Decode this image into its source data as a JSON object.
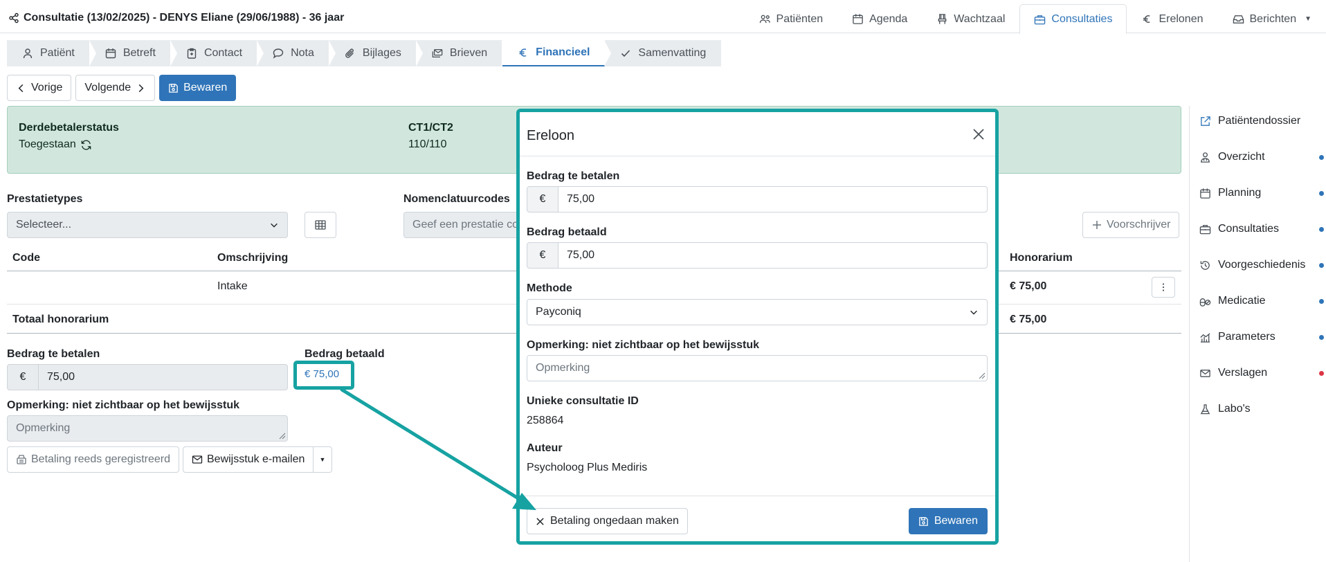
{
  "header": {
    "title": "Consultatie (13/02/2025) - DENYS Eliane (29/06/1988) - 36 jaar",
    "nav": [
      {
        "label": "Patiënten",
        "icon": "users-icon"
      },
      {
        "label": "Agenda",
        "icon": "calendar-icon"
      },
      {
        "label": "Wachtzaal",
        "icon": "chair-icon"
      },
      {
        "label": "Consultaties",
        "icon": "briefcase-icon",
        "active": true
      },
      {
        "label": "Erelonen",
        "icon": "euro-icon"
      },
      {
        "label": "Berichten",
        "icon": "inbox-icon"
      }
    ]
  },
  "subtabs": [
    {
      "label": "Patiënt",
      "icon": "user-icon"
    },
    {
      "label": "Betreft",
      "icon": "calendar-icon"
    },
    {
      "label": "Contact",
      "icon": "clipboard-icon"
    },
    {
      "label": "Nota",
      "icon": "comment-icon"
    },
    {
      "label": "Bijlages",
      "icon": "paperclip-icon"
    },
    {
      "label": "Brieven",
      "icon": "envelopes-icon"
    },
    {
      "label": "Financieel",
      "icon": "euro-icon",
      "active": true
    },
    {
      "label": "Samenvatting",
      "icon": "check-icon"
    }
  ],
  "navigation": {
    "prev": "Vorige",
    "next": "Volgende",
    "save": "Bewaren"
  },
  "status": {
    "third_party_label": "Derdebetalerstatus",
    "third_party_value": "Toegestaan",
    "ct_label": "CT1/CT2",
    "ct_value": "110/110"
  },
  "form": {
    "prestatietypes_label": "Prestatietypes",
    "prestatietypes_value": "Selecteer...",
    "nomenclature_label": "Nomenclatuurcodes",
    "nomenclature_placeholder": "Geef een prestatie co",
    "prescriber_button": "Voorschrijver"
  },
  "table": {
    "headers": {
      "code": "Code",
      "description": "Omschrijving",
      "fee": "Honorarium"
    },
    "rows": [
      {
        "code": "",
        "description": "Intake",
        "fee": "€ 75,00"
      }
    ],
    "total_label": "Totaal honorarium",
    "total_value": "€ 75,00"
  },
  "payment": {
    "to_pay_label": "Bedrag te betalen",
    "currency": "€",
    "to_pay_value": "75,00",
    "paid_label": "Bedrag betaald",
    "paid_value": "€ 75,00",
    "remark_label": "Opmerking: niet zichtbaar op het bewijsstuk",
    "remark_placeholder": "Opmerking",
    "registered_button": "Betaling reeds geregistreerd",
    "email_button": "Bewijsstuk e-mailen"
  },
  "sidebar": {
    "items": [
      {
        "label": "Patiëntendossier",
        "icon": "external-link-icon",
        "dot": ""
      },
      {
        "label": "Overzicht",
        "icon": "user-doctor-icon",
        "dot": "#2f74b8"
      },
      {
        "label": "Planning",
        "icon": "calendar-icon",
        "dot": "#2f74b8"
      },
      {
        "label": "Consultaties",
        "icon": "briefcase-icon",
        "dot": "#2f74b8"
      },
      {
        "label": "Voorgeschiedenis",
        "icon": "history-icon",
        "dot": "#2f74b8"
      },
      {
        "label": "Medicatie",
        "icon": "pills-icon",
        "dot": "#2f74b8"
      },
      {
        "label": "Parameters",
        "icon": "chart-icon",
        "dot": "#2f74b8"
      },
      {
        "label": "Verslagen",
        "icon": "envelope-icon",
        "dot": "#dc3545"
      },
      {
        "label": "Labo's",
        "icon": "flask-icon",
        "dot": ""
      }
    ]
  },
  "modal": {
    "title": "Ereloon",
    "to_pay_label": "Bedrag te betalen",
    "to_pay_value": "75,00",
    "paid_label": "Bedrag betaald",
    "paid_value": "75,00",
    "currency": "€",
    "method_label": "Methode",
    "method_value": "Payconiq",
    "remark_label": "Opmerking: niet zichtbaar op het bewijsstuk",
    "remark_placeholder": "Opmerking",
    "id_label": "Unieke consultatie ID",
    "id_value": "258864",
    "author_label": "Auteur",
    "author_value": "Psycholoog Plus Mediris",
    "undo_button": "Betaling ongedaan maken",
    "save_button": "Bewaren"
  },
  "colors": {
    "primary": "#2f74b8",
    "highlight": "#17a2a2",
    "success_bg": "#d1e7dd"
  }
}
